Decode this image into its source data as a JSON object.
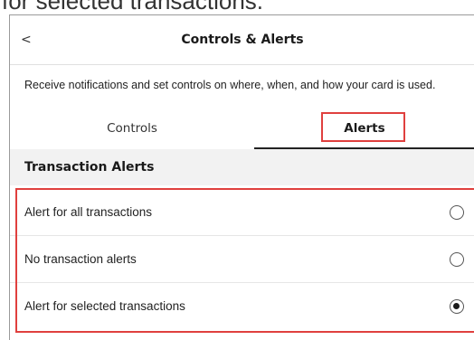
{
  "caption": "for selected transactions.",
  "header": {
    "back_label": "<",
    "title": "Controls & Alerts"
  },
  "description": "Receive notifications and set controls on where, when, and how your card is used.",
  "tabs": [
    {
      "label": "Controls",
      "selected": false
    },
    {
      "label": "Alerts",
      "selected": true
    }
  ],
  "section": {
    "title": "Transaction Alerts"
  },
  "options": [
    {
      "label": "Alert for all transactions",
      "selected": false
    },
    {
      "label": "No transaction alerts",
      "selected": false
    },
    {
      "label": "Alert for selected transactions",
      "selected": true
    }
  ],
  "colors": {
    "highlight": "#e0403e",
    "section_bg": "#f2f2f2",
    "tab_underline": "#222222"
  },
  "icons": {
    "back": "chevron-left-icon",
    "radio_unchecked": "radio-unchecked-icon",
    "radio_checked": "radio-checked-icon"
  }
}
